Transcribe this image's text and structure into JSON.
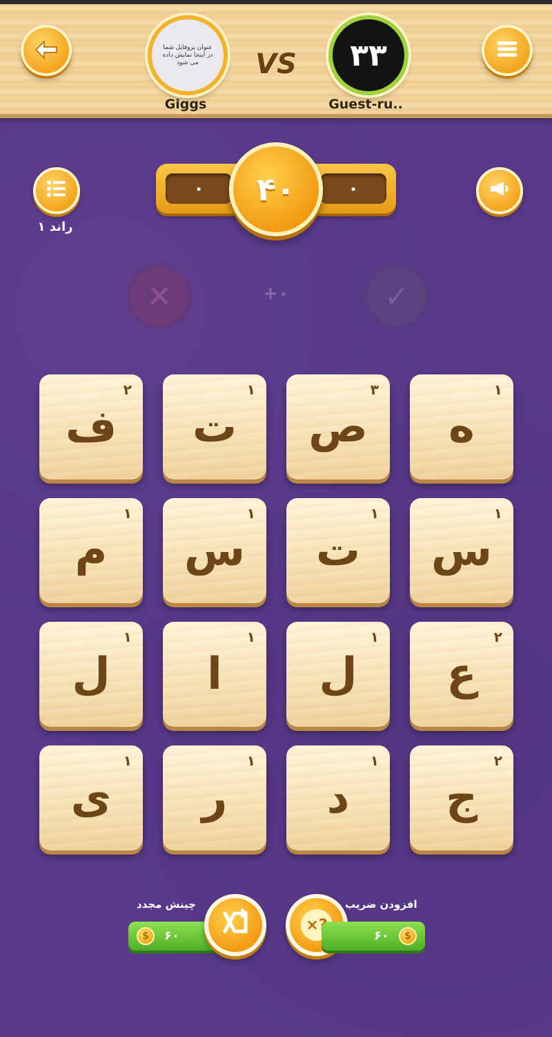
{
  "header": {
    "back_icon": "arrow-left-icon",
    "menu_icon": "hamburger-menu-icon",
    "vs_label": "VS",
    "player_left": {
      "name": "Giggs",
      "avatar_text": "عنوان پروفایل شما در اینجا نمایش داده می شود"
    },
    "player_right": {
      "name": "Guest-ru..",
      "avatar_number": "۳۳"
    }
  },
  "scoreboard": {
    "left_score": "۰",
    "right_score": "۰",
    "timer": "۴۰"
  },
  "round": {
    "label": "راند ۱",
    "icon": "list-icon"
  },
  "sound": {
    "icon": "megaphone-icon"
  },
  "answer_row": {
    "reject_icon": "x-icon",
    "accept_icon": "check-icon",
    "word_score": "+۰"
  },
  "tiles": [
    {
      "letter": "ف",
      "points": "۲"
    },
    {
      "letter": "ت",
      "points": "۱"
    },
    {
      "letter": "ص",
      "points": "۳"
    },
    {
      "letter": "ه",
      "points": "۱"
    },
    {
      "letter": "م",
      "points": "۱"
    },
    {
      "letter": "س",
      "points": "۱"
    },
    {
      "letter": "ت",
      "points": "۱"
    },
    {
      "letter": "س",
      "points": "۱"
    },
    {
      "letter": "ل",
      "points": "۱"
    },
    {
      "letter": "ا",
      "points": "۱"
    },
    {
      "letter": "ل",
      "points": "۱"
    },
    {
      "letter": "ع",
      "points": "۲"
    },
    {
      "letter": "ی",
      "points": "۱"
    },
    {
      "letter": "ر",
      "points": "۱"
    },
    {
      "letter": "د",
      "points": "۱"
    },
    {
      "letter": "ج",
      "points": "۲"
    }
  ],
  "boosters": {
    "shuffle": {
      "label": "چینش مجدد",
      "price": "۶۰",
      "icon": "shuffle-icon",
      "coin_icon": "coin-icon"
    },
    "multiplier": {
      "label": "افزودن ضریب",
      "price": "۶۰",
      "icon": "multiplier-icon",
      "coin_icon": "coin-icon"
    }
  },
  "colors": {
    "background": "#58398a",
    "accent_orange": "#f29a12",
    "tile_face": "#f7e2b6",
    "tile_text": "#6e4516",
    "price_green": "#4fae26"
  }
}
